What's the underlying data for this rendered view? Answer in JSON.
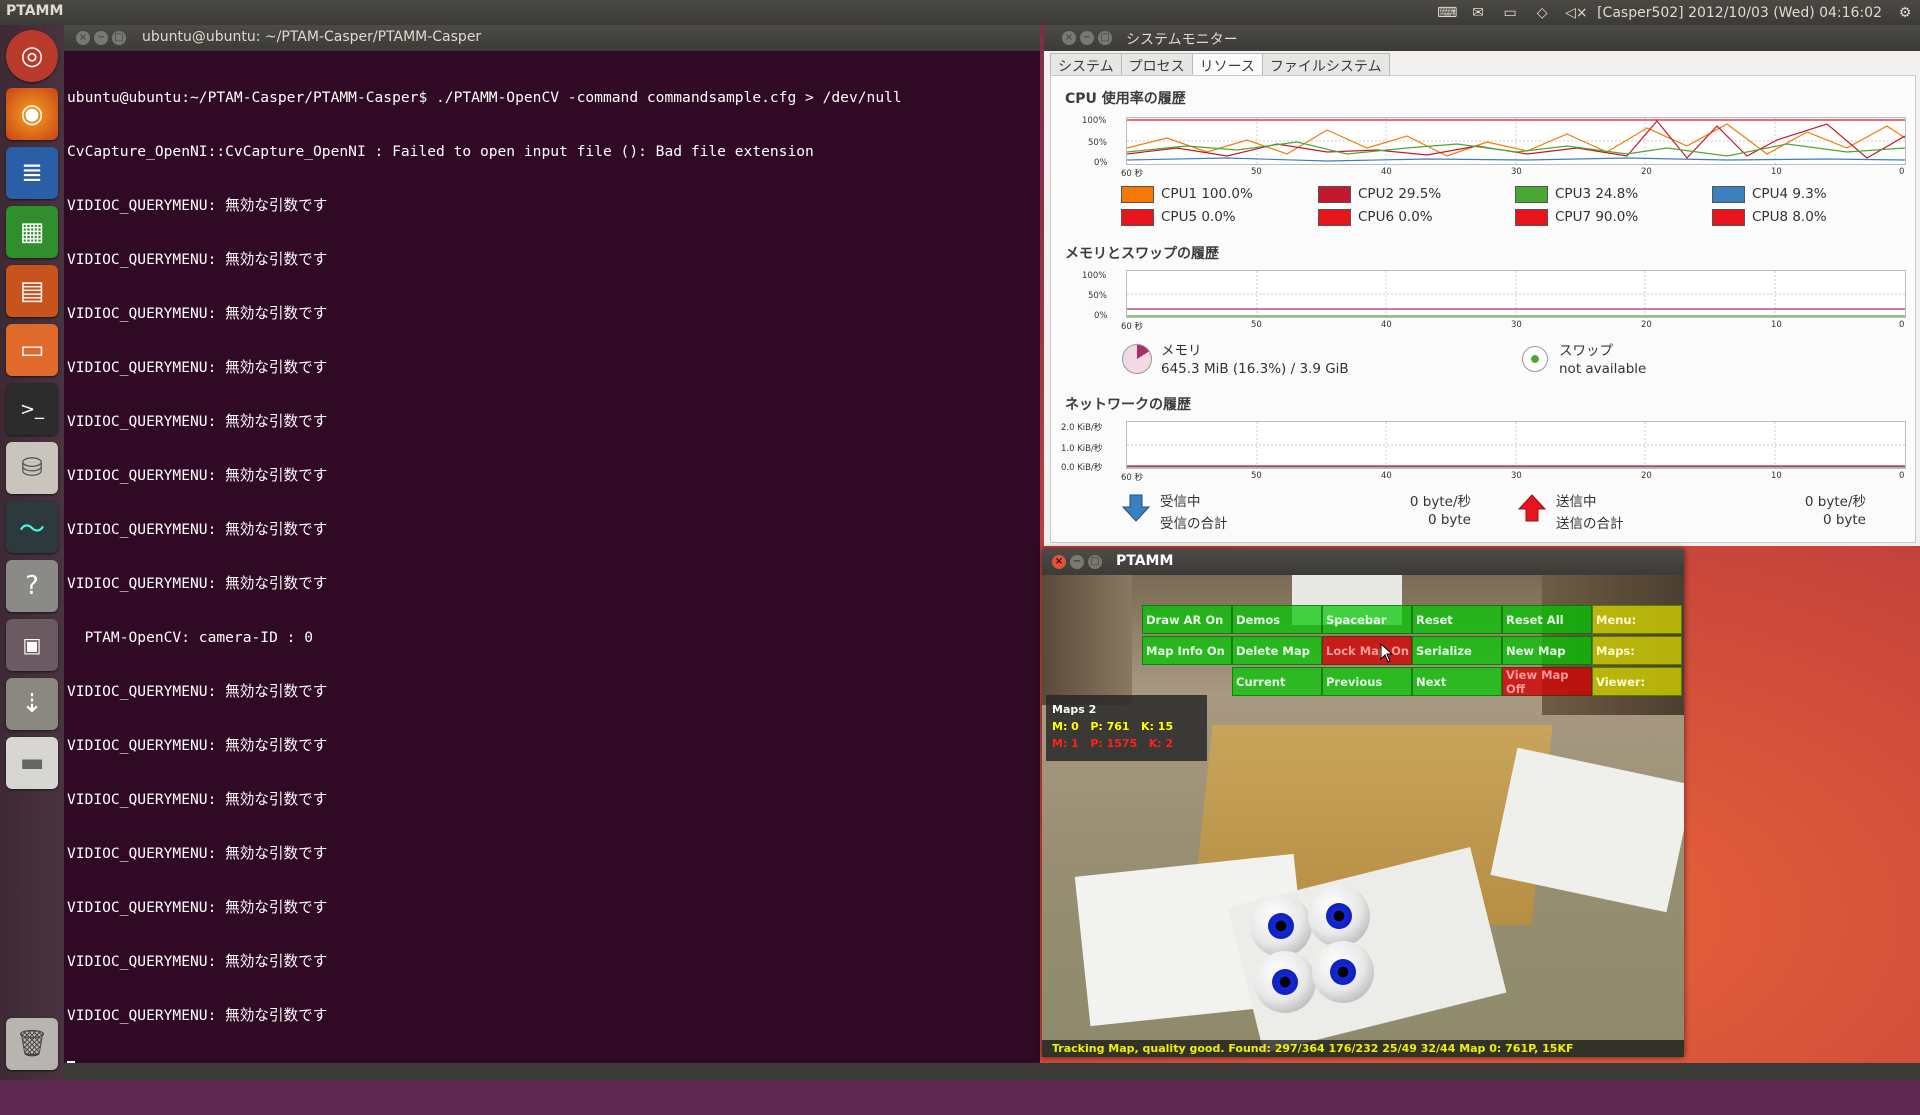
{
  "top_panel": {
    "app_title": "PTAMM",
    "clock": "[Casper502] 2012/10/03 (Wed) 04:16:02",
    "indicator_icons": [
      "keyboard-icon",
      "mail-icon",
      "battery-icon",
      "wifi-icon",
      "volume-muted-icon"
    ]
  },
  "launcher": {
    "items": [
      "dash-home",
      "firefox",
      "libreoffice-writer",
      "libreoffice-calc",
      "libreoffice-impress",
      "files",
      "terminal",
      "software-center",
      "system-monitor",
      "help",
      "workspace-switcher",
      "usb-drive",
      "removable-disk",
      "trash"
    ]
  },
  "terminal": {
    "title": "ubuntu@ubuntu: ~/PTAM-Casper/PTAMM-Casper",
    "lines": [
      "ubuntu@ubuntu:~/PTAM-Casper/PTAMM-Casper$ ./PTAMM-OpenCV -command commandsample.cfg > /dev/null",
      "CvCapture_OpenNI::CvCapture_OpenNI : Failed to open input file (): Bad file extension",
      "VIDIOC_QUERYMENU: 無効な引数です",
      "VIDIOC_QUERYMENU: 無効な引数です",
      "VIDIOC_QUERYMENU: 無効な引数です",
      "VIDIOC_QUERYMENU: 無効な引数です",
      "VIDIOC_QUERYMENU: 無効な引数です",
      "VIDIOC_QUERYMENU: 無効な引数です",
      "VIDIOC_QUERYMENU: 無効な引数です",
      "VIDIOC_QUERYMENU: 無効な引数です",
      "  PTAM-OpenCV: camera-ID : 0",
      "VIDIOC_QUERYMENU: 無効な引数です",
      "VIDIOC_QUERYMENU: 無効な引数です",
      "VIDIOC_QUERYMENU: 無効な引数です",
      "VIDIOC_QUERYMENU: 無効な引数です",
      "VIDIOC_QUERYMENU: 無効な引数です",
      "VIDIOC_QUERYMENU: 無効な引数です",
      "VIDIOC_QUERYMENU: 無効な引数です"
    ]
  },
  "sysmon": {
    "title": "システムモニター",
    "tabs": [
      "システム",
      "プロセス",
      "リソース",
      "ファイルシステム"
    ],
    "active_tab": "リソース",
    "cpu_title": "CPU 使用率の履歴",
    "mem_title": "メモリとスワップの履歴",
    "net_title": "ネットワークの履歴",
    "x_ticks": [
      "60 秒",
      "50",
      "40",
      "30",
      "20",
      "10",
      "0"
    ],
    "pct_ticks": [
      "100%",
      "50%",
      "0%"
    ],
    "net_ticks": [
      "2.0 KiB/秒",
      "1.0 KiB/秒",
      "0.0 KiB/秒"
    ],
    "cpus": [
      {
        "label": "CPU1 100.0%",
        "color": "#f57900"
      },
      {
        "label": "CPU2 29.5%",
        "color": "#c4182e"
      },
      {
        "label": "CPU3 24.8%",
        "color": "#4aa832"
      },
      {
        "label": "CPU4 9.3%",
        "color": "#3c7fbf"
      },
      {
        "label": "CPU5 0.0%",
        "color": "#e8141c"
      },
      {
        "label": "CPU6 0.0%",
        "color": "#e8141c"
      },
      {
        "label": "CPU7 90.0%",
        "color": "#e8141c"
      },
      {
        "label": "CPU8 8.0%",
        "color": "#e8141c"
      }
    ],
    "memory": {
      "label": "メモリ",
      "value": "645.3 MiB (16.3%) / 3.9 GiB"
    },
    "swap": {
      "label": "スワップ",
      "value": "not available"
    },
    "net": {
      "recv_label": "受信中",
      "recv_value": "0 byte/秒",
      "recv_total_label": "受信の合計",
      "recv_total_value": "0 byte",
      "send_label": "送信中",
      "send_value": "0 byte/秒",
      "send_total_label": "送信の合計",
      "send_total_value": "0 byte"
    }
  },
  "ptamm": {
    "title": "PTAMM",
    "menu": {
      "row1": [
        "Draw  AR  On",
        "Demos",
        "Spacebar",
        "Reset",
        "Reset  All",
        "Menu:"
      ],
      "row2": [
        "Map  Info  On",
        "Delete  Map",
        "Lock  Map  On",
        "Serialize",
        "New  Map",
        "Maps:"
      ],
      "row3": [
        "Current",
        "Previous",
        "Next",
        "View  Map  Off",
        "Viewer:"
      ]
    },
    "maps_info": {
      "title": "Maps 2",
      "line1": "M: 0   P: 761   K: 15",
      "line2": "M: 1   P: 1575   K: 2"
    },
    "status": "Tracking Map, quality good. Found: 297/364 176/232 25/49 32/44 Map 0: 761P, 15KF"
  },
  "colors": {
    "terminal_bg": "#300a24",
    "accent": "#dd4814"
  }
}
